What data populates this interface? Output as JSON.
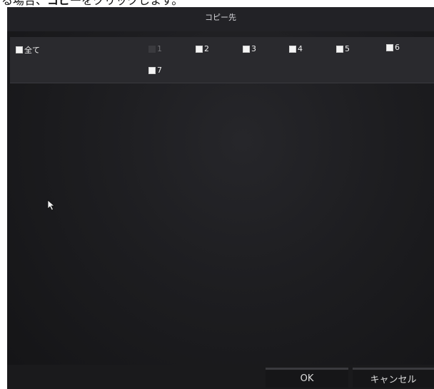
{
  "caption": {
    "prefix": "る場合、",
    "bold": "コピー",
    "suffix": "をクリックします。"
  },
  "dialog": {
    "title": "コピー先"
  },
  "options": {
    "all": "全て",
    "channels": [
      {
        "label": "1",
        "enabled": false
      },
      {
        "label": "2",
        "enabled": true
      },
      {
        "label": "3",
        "enabled": true
      },
      {
        "label": "4",
        "enabled": true
      },
      {
        "label": "5",
        "enabled": true
      },
      {
        "label": "6",
        "enabled": true
      },
      {
        "label": "7",
        "enabled": true
      }
    ]
  },
  "buttons": {
    "ok": "OK",
    "cancel": "キャンセル"
  },
  "colors": {
    "screen_bg": "#1d1d20",
    "panel_bg": "#2a2a2e",
    "text": "#ececec",
    "checkbox": "#f4f4f4"
  },
  "icons": {
    "cursor": "mouse-pointer-icon"
  }
}
